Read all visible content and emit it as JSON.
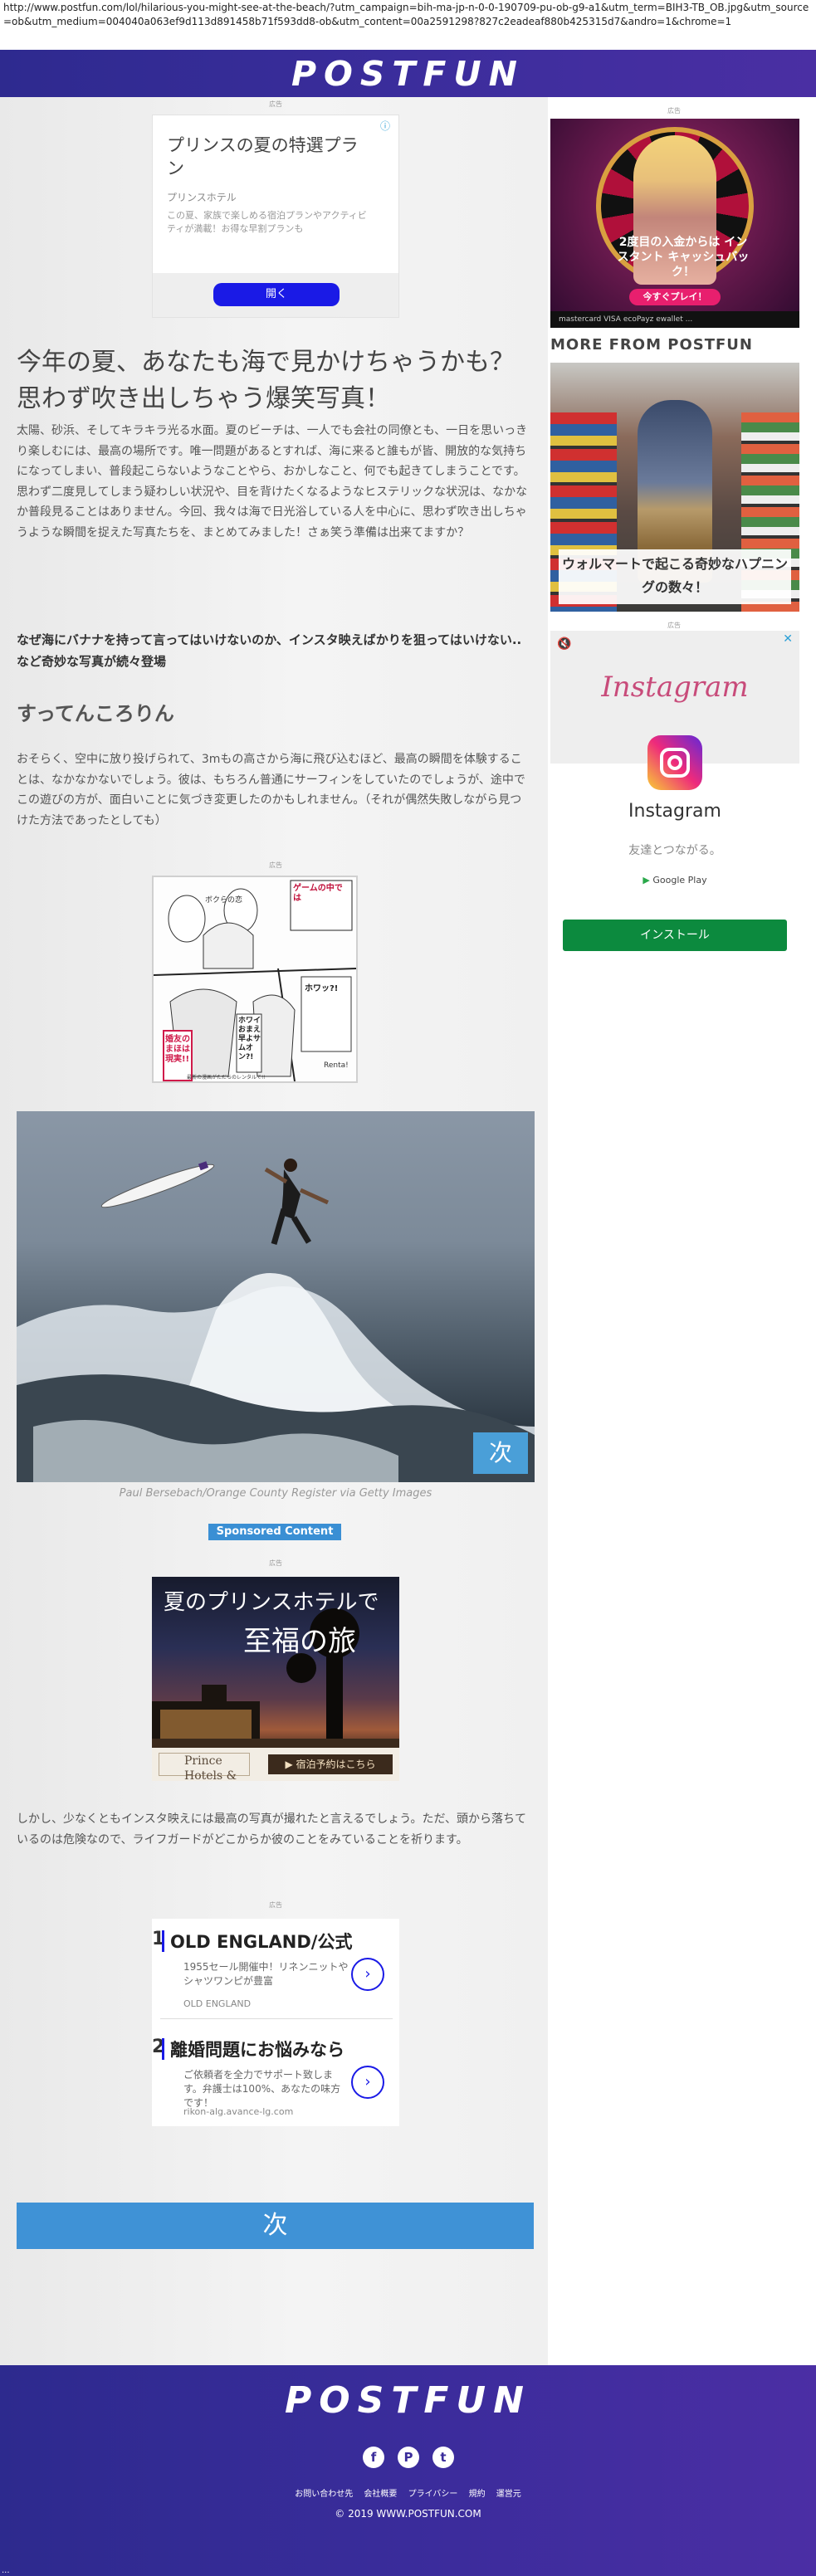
{
  "browser": {
    "url": "http://www.postfun.com/lol/hilarious-you-might-see-at-the-beach/?utm_campaign=bih-ma-jp-n-0-0-190709-pu-ob-g9-a1&utm_term=BIH3-TB_OB.jpg&utm_source=ob&utm_medium=004040a063ef9d113d891458b71f593dd8-ob&utm_content=00a2591298?827c2eadeaf880b425315d7&andro=1&chrome=1"
  },
  "header": {
    "logo": "POSTFUN"
  },
  "ad_label": "広告",
  "ad_top": {
    "title": "プリンスの夏の特選プラン",
    "sponsor": "プリンスホテル",
    "desc": "この夏、家族で楽しめる宿泊プランやアクティビティが満載！お得な早割プランも",
    "button": "開く",
    "info_icon": "ⓘ"
  },
  "article": {
    "title": "今年の夏、あなたも海で見かけちゃうかも？思わず吹き出しちゃう爆笑写真！",
    "intro": "太陽、砂浜、そしてキラキラ光る水面。夏のビーチは、一人でも会社の同僚とも、一日を思いっきり楽しむには、最高の場所です。唯一問題があるとすれば、海に来ると誰もが皆、開放的な気持ちになってしまい、普段起こらないようなことやら、おかしなこと、何でも起きてしまうことです。思わず二度見してしまう疑わしい状況や、目を背けたくなるようなヒステリックな状況は、なかなか普段見ることはありません。今回、我々は海で日光浴している人を中心に、思わず吹き出しちゃうような瞬間を捉えた写真たちを、まとめてみました！さぁ笑う準備は出来てますか？",
    "lead": "なぜ海にバナナを持って言ってはいけないのか、インスタ映えばかりを狙ってはいけない..など奇妙な写真が続々登場",
    "subheading": "すってんころりん",
    "para2": "おそらく、空中に放り投げられて、3mもの高さから海に飛び込むほど、最高の瞬間を体験することは、なかなかないでしょう。彼は、もちろん普通にサーフィンをしていたのでしょうが、途中でこの遊びの方が、面白いことに気づき変更したのかもしれません。（それが偶然失敗しながら見つけた方法であったとしても）",
    "photo_credit": "Paul Bersebach/Orange County Register via Getty Images",
    "photo_next": "次",
    "para3": "しかし、少なくともインスタ映えには最高の写真が撮れたと言えるでしょう。ただ、頭から落ちているのは危険なので、ライフガードがどこからか彼のことをみていることを祈ります。",
    "next_button": "次"
  },
  "manga_ad": {
    "bubble1": "ゲームの中では",
    "bubble2": "ボクらの恋",
    "shout1": "婚友のまほは現実!!",
    "shout2": "ホワイおまえ早よサムオン?!",
    "shout3": "ホワッ?!",
    "brand": "Renta!",
    "caption": "最新の漫画がただちのレンタルで!!"
  },
  "sponsored_label": "Sponsored Content",
  "ad_prince": {
    "line1": "夏のプリンスホテルで",
    "line2": "至福の旅",
    "brand": "Prince Hotels & Resorts",
    "cta": "▶ 宿泊予約はこちら"
  },
  "ad_list": {
    "items": [
      {
        "num": "1",
        "title": "OLD ENGLAND/公式",
        "desc": "1955セール開催中！リネンニットやシャツワンピが豊富",
        "source": "OLD ENGLAND",
        "go": "›"
      },
      {
        "num": "2",
        "title": "離婚問題にお悩みなら",
        "desc": "ご依頼者を全力でサポート致します。弁護士は100%、あなたの味方です！",
        "source": "rikon-alg.avance-lg.com",
        "go": "›"
      }
    ]
  },
  "sidebar": {
    "casino_ad": {
      "text": "2度目の入金からは インスタント キャッシュバック！",
      "play": "今すぐプレイ！",
      "payments": "mastercard  VISA  ecoPayz  ewallet  ..."
    },
    "more_heading": "MORE FROM POSTFUN",
    "feature_caption": "ウォルマートで起こる奇妙なハプニングの数々！",
    "insta_ad": {
      "wordmark": "Instagram",
      "name": "Instagram",
      "tagline": "友達とつながる。",
      "store": "Google Play",
      "install": "インストール",
      "mute_icon": "🔇",
      "close": "✕"
    }
  },
  "footer": {
    "logo": "POSTFUN",
    "social": [
      "f",
      "P",
      "t"
    ],
    "links": [
      "お問い合わせ先",
      "会社概要",
      "プライバシー",
      "規約",
      "運営元"
    ],
    "copyright": "© 2019 WWW.POSTFUN.COM"
  },
  "trailing": "..."
}
